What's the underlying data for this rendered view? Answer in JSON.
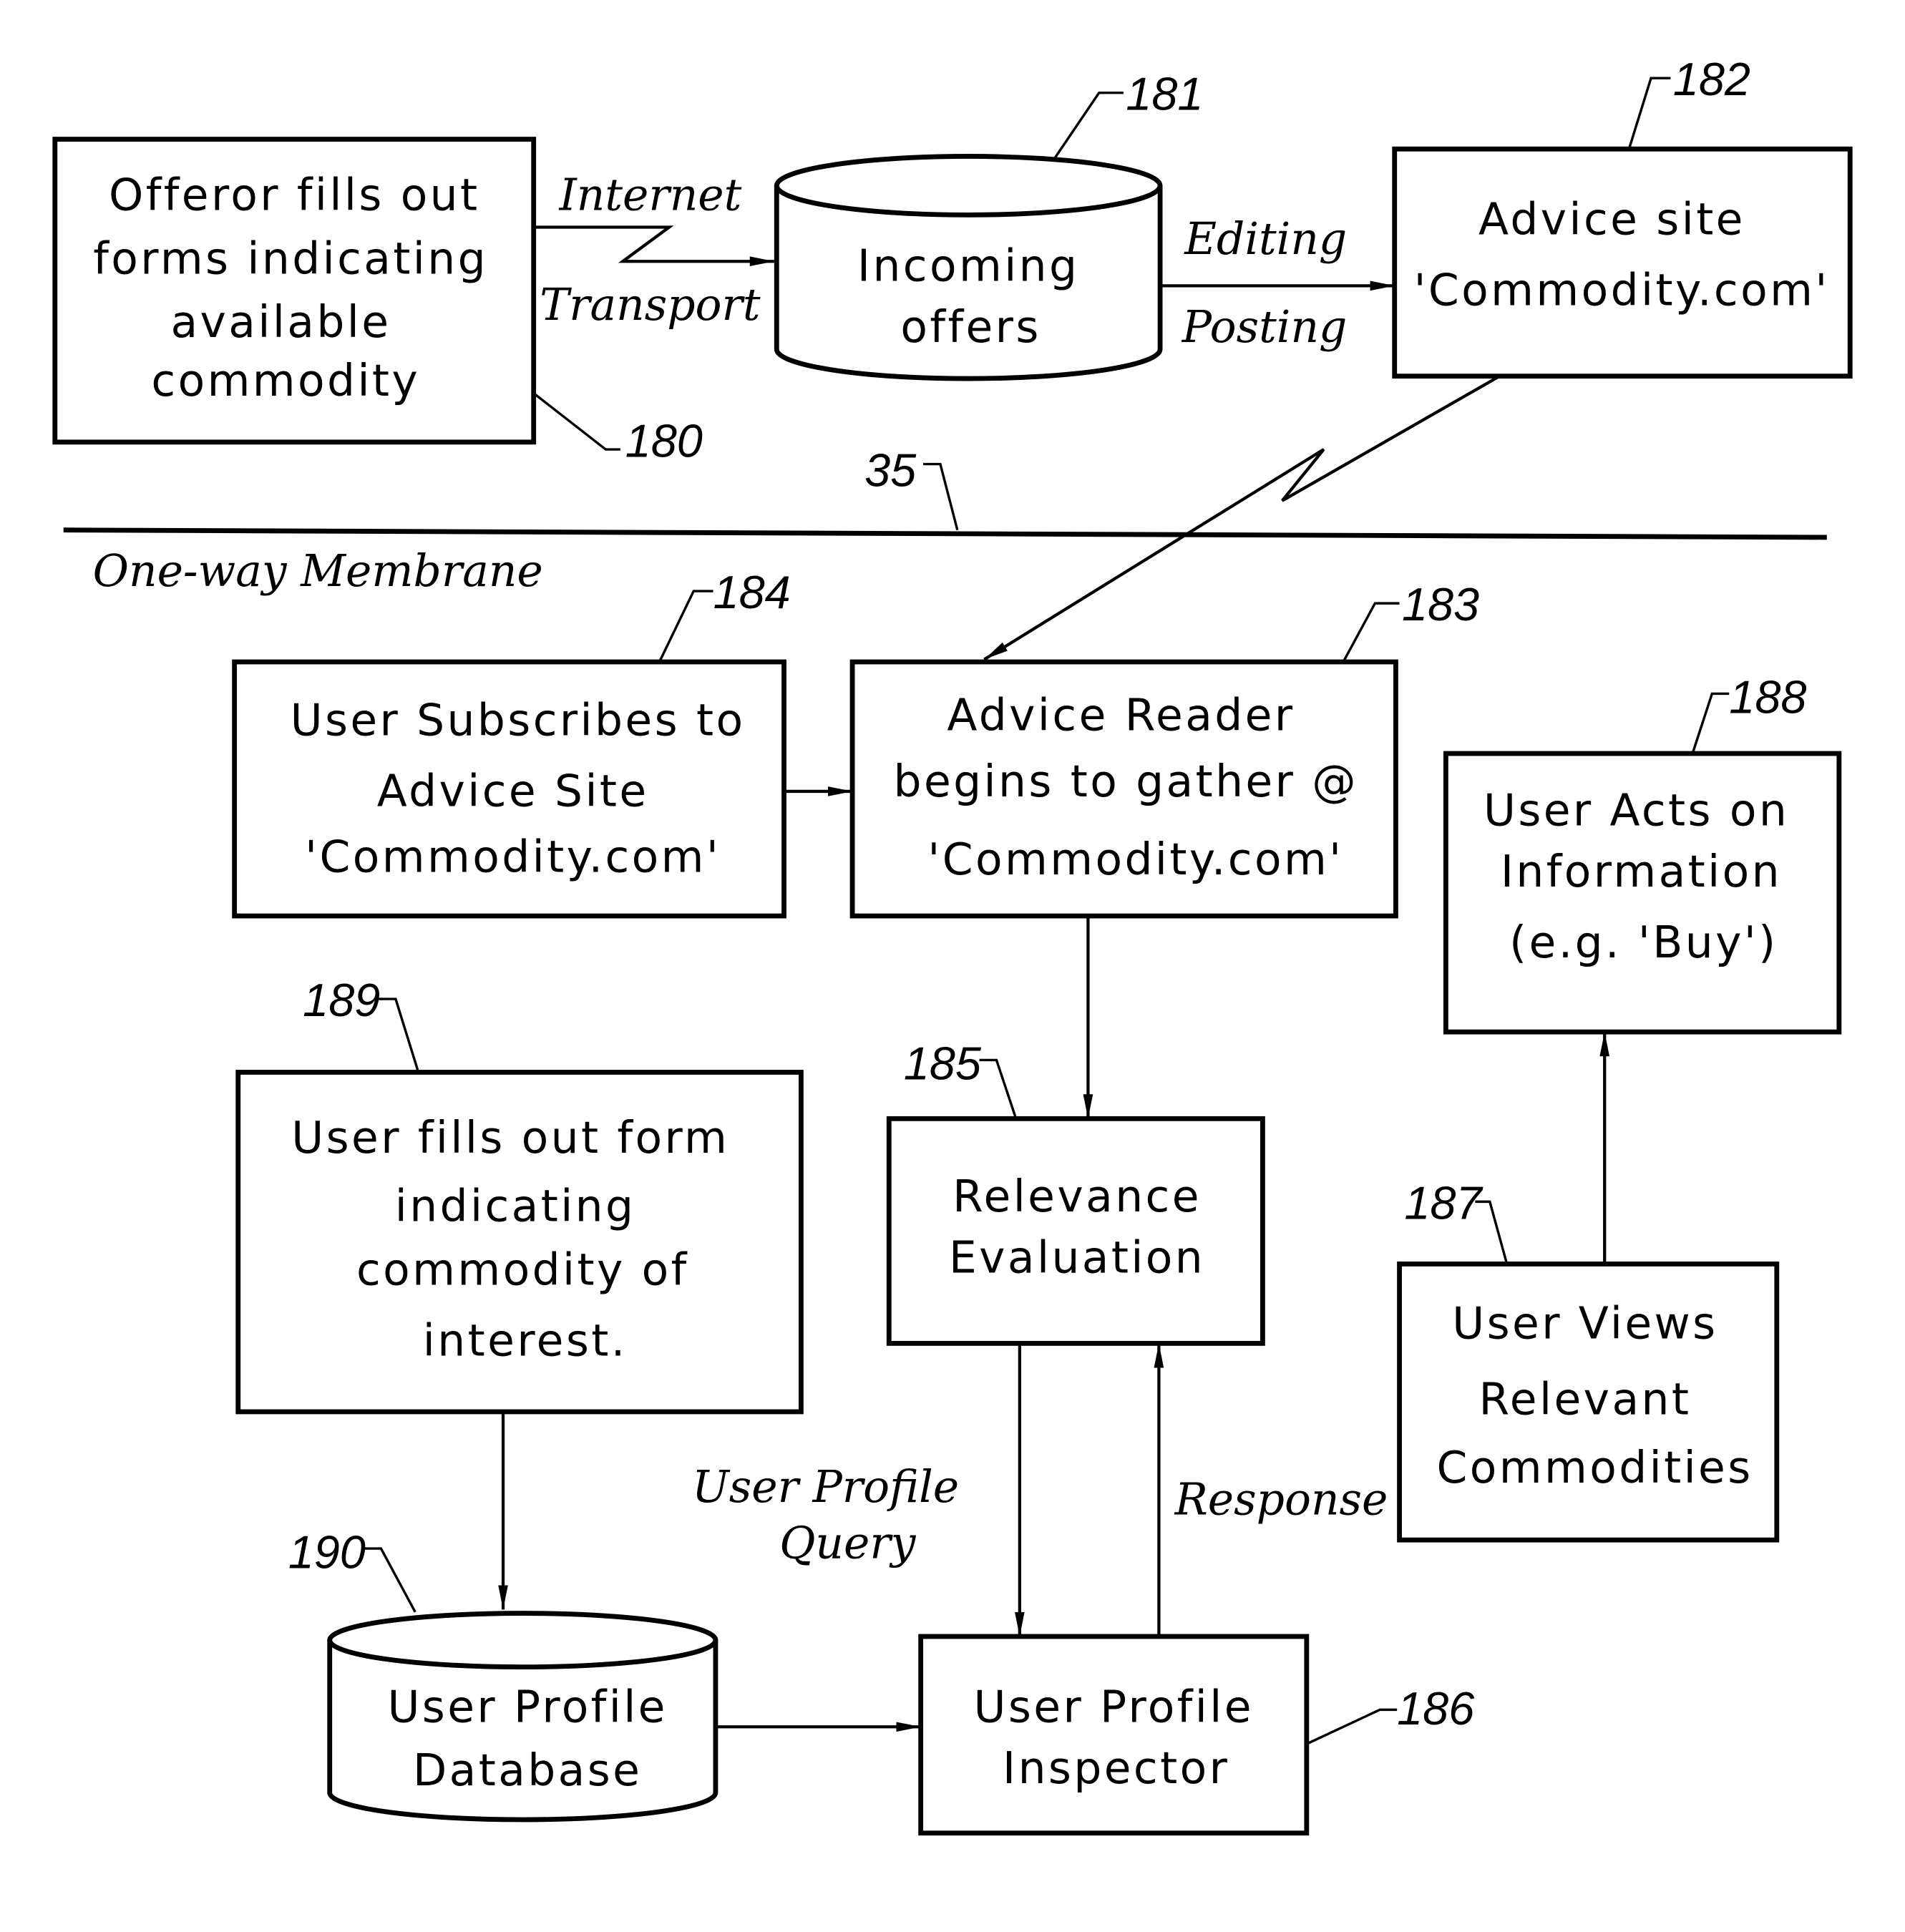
{
  "diagram": {
    "membrane_label": "One-way Membrane",
    "membrane_ref": "35",
    "nodes": {
      "n180": {
        "ref": "180",
        "shape": "box",
        "lines": [
          "Offeror fills out",
          "forms indicating",
          "available",
          "commodity"
        ]
      },
      "n181": {
        "ref": "181",
        "shape": "cylinder",
        "lines": [
          "Incoming",
          "offers"
        ]
      },
      "n182": {
        "ref": "182",
        "shape": "box",
        "lines": [
          "Advice site",
          "'Commodity.com'"
        ]
      },
      "n183": {
        "ref": "183",
        "shape": "box",
        "lines": [
          "Advice Reader",
          "begins to gather @",
          "'Commodity.com'"
        ]
      },
      "n184": {
        "ref": "184",
        "shape": "box",
        "lines": [
          "User Subscribes to",
          "Advice Site",
          "'Commodity.com'"
        ]
      },
      "n185": {
        "ref": "185",
        "shape": "box",
        "lines": [
          "Relevance",
          "Evaluation"
        ]
      },
      "n186": {
        "ref": "186",
        "shape": "box",
        "lines": [
          "User Profile",
          "Inspector"
        ]
      },
      "n187": {
        "ref": "187",
        "shape": "box",
        "lines": [
          "User Views",
          "Relevant",
          "Commodities"
        ]
      },
      "n188": {
        "ref": "188",
        "shape": "box",
        "lines": [
          "User Acts on",
          "Information",
          "(e.g. 'Buy')"
        ]
      },
      "n189": {
        "ref": "189",
        "shape": "box",
        "lines": [
          "User fills out form",
          "indicating",
          "commodity of",
          "interest."
        ]
      },
      "n190": {
        "ref": "190",
        "shape": "cylinder",
        "lines": [
          "User Profile",
          "Database"
        ]
      }
    },
    "edge_labels": {
      "internet": "Internet",
      "transport": "Transport",
      "editing": "Editing",
      "posting": "Posting",
      "user_profile_query_1": "User Profile",
      "user_profile_query_2": "Query",
      "response": "Response"
    },
    "edges": [
      {
        "from": "180",
        "to": "181",
        "label": "Internet Transport"
      },
      {
        "from": "181",
        "to": "182",
        "label": "Editing Posting"
      },
      {
        "from": "182",
        "to": "183",
        "label": ""
      },
      {
        "from": "184",
        "to": "183",
        "label": ""
      },
      {
        "from": "183",
        "to": "185",
        "label": ""
      },
      {
        "from": "185",
        "to": "186",
        "label": "User Profile Query"
      },
      {
        "from": "186",
        "to": "185",
        "label": "Response"
      },
      {
        "from": "189",
        "to": "190",
        "label": ""
      },
      {
        "from": "190",
        "to": "186",
        "label": ""
      },
      {
        "from": "187",
        "to": "188",
        "label": ""
      }
    ]
  }
}
